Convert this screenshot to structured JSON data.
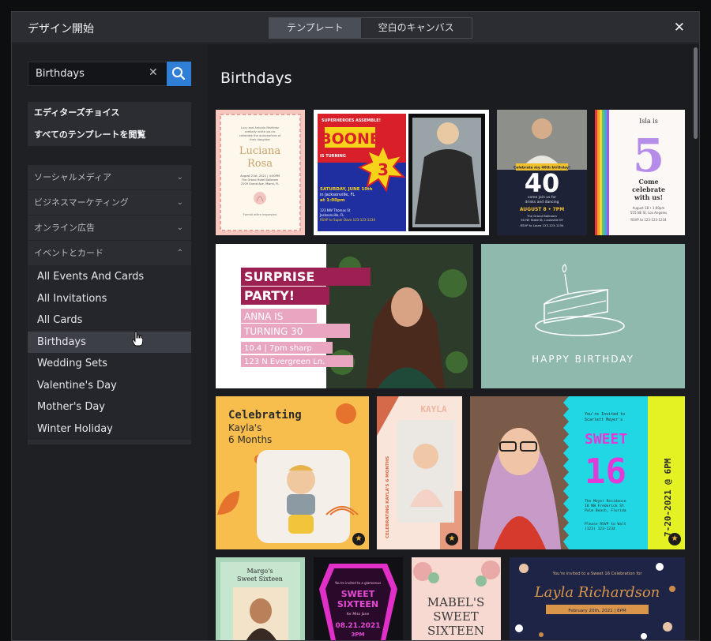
{
  "dialog": {
    "title": "デザイン開始"
  },
  "tabs": [
    {
      "label": "テンプレート",
      "active": true
    },
    {
      "label": "空白のキャンバス",
      "active": false
    }
  ],
  "search": {
    "value": "Birthdays"
  },
  "quick_links": [
    "エディターズチョイス",
    "すべてのテンプレートを閲覧"
  ],
  "categories": [
    "ソーシャルメディア",
    "ビジネスマーケティング",
    "オンライン広告",
    "イベントとカード"
  ],
  "subcategories": [
    "All Events And Cards",
    "All Invitations",
    "All Cards",
    "Birthdays",
    "Wedding Sets",
    "Valentine's Day",
    "Mother's Day",
    "Winter Holiday"
  ],
  "selected_subcategory": "Birthdays",
  "heading": "Birthdays",
  "templates": {
    "t1": {
      "lines": [
        "Lucy and Antonio Martinez",
        "cordially invite you to",
        "celebrate the quinceañera of",
        "their daughter"
      ],
      "name1": "Luciana",
      "name2": "Rosa",
      "date": "August 21st, 2021 | 4:00PM",
      "venue": "The Grand Hotel Ballroom",
      "addr": "2109 Grand Ave, Miami, FL",
      "rsvp": "Formal attire requested"
    },
    "t2": {
      "kicker": "SUPERHEROES ASSEMBLE!",
      "name": "BOONE",
      "turning": "IS TURNING",
      "age": "3",
      "date": "SATURDAY, JUNE 10th",
      "place": "in Jacksonville, FL",
      "time": "at 1:00pm",
      "addr": "123 NW Thomas St",
      "city": "Jacksonville, FL",
      "rsvp": "RSVP to Super Dave 123-123-1234"
    },
    "t3": {
      "banner": "Celebrate my 40th birthday!",
      "age": "40",
      "invite": "come join us for",
      "invite2": "drinks and dancing",
      "date": "AUGUST 8 • 7PM",
      "venue": "The Grand Ballroom",
      "addr": "50 NE State St, Louisville KY",
      "rsvp": "RSVP to Laura 123-123-1234"
    },
    "t4": {
      "line1": "Isla is",
      "age": "5",
      "line2": "Come",
      "line3": "celebrate",
      "line4": "with us!",
      "date": "August 18 • 1:00pm",
      "addr": "555 NE St, Los Angeles",
      "rsvp": "RSVP to 123-123-1234"
    },
    "t5": {
      "l1": "SURPRISE",
      "l2": "PARTY!",
      "l3": "ANNA IS",
      "l4": "TURNING 30",
      "l5": "10.4 | 7pm sharp",
      "l6": "123 N Evergreen Ln."
    },
    "t6": {
      "text": "HAPPY BIRTHDAY"
    },
    "t7": {
      "l1": "Celebrating",
      "l2": "Kayla's",
      "l3": "6 Months"
    },
    "t8": {
      "name": "KAYLA",
      "side": "CELEBRATING KAYLA'S 6 MONTHS"
    },
    "t9": {
      "invite": "You're Invited to",
      "name": "Scarlett Meyer's",
      "sweet": "SWEET",
      "age": "16",
      "res": "The Meyer Residence",
      "addr": "18 NW Frederick St",
      "city": "Palm Beach, Florida",
      "rsvp": "Please RSVP to Walt",
      "phone": "(123) 123-1234",
      "side": "7-20-2021 @ 6PM"
    },
    "t10": {
      "l1": "Margo's",
      "l2": "Sweet Sixteen"
    },
    "t11": {
      "small": "You're invited to a glamorous",
      "l1": "SWEET",
      "l2": "SIXTEEN",
      "l3": "for Miss Jane",
      "date": "08.21.2021",
      "time": "3PM"
    },
    "t12": {
      "l1": "MABEL'S",
      "l2": "SWEET",
      "l3": "SIXTEEN"
    },
    "t13": {
      "invite": "You're invited to a Sweet 16 Celebration for",
      "name": "Layla Richardson",
      "date": "February 20th, 2021 | 8PM"
    }
  },
  "colors": {
    "accent": "#2f7fd6",
    "selected": "#3c3f46",
    "sidebar": "#1e2024",
    "star": "#f0b43a"
  }
}
